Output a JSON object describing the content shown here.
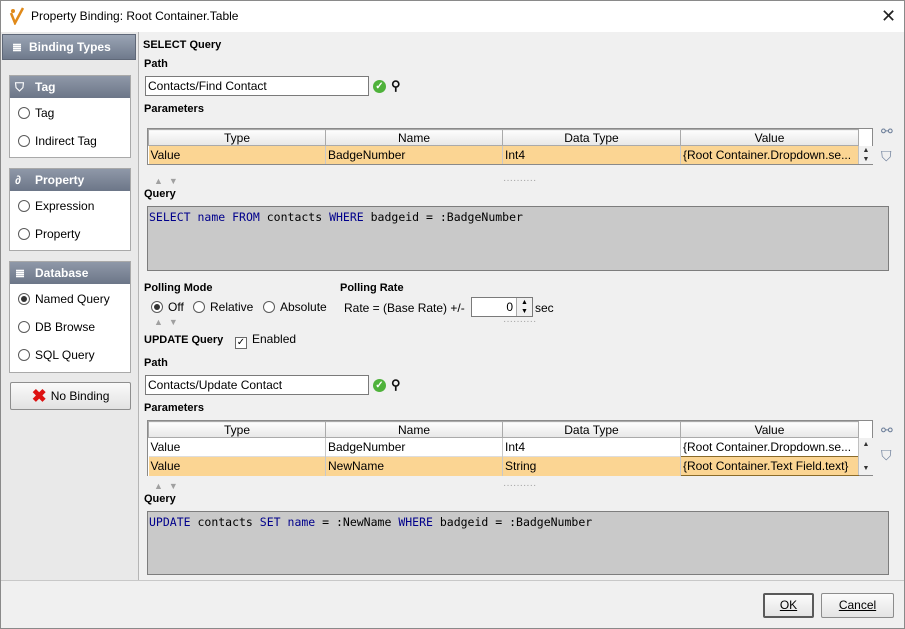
{
  "window": {
    "title": "Property Binding: Root Container.Table"
  },
  "left": {
    "header": "Binding Types",
    "groups": [
      {
        "title": "Tag",
        "items": [
          "Tag",
          "Indirect Tag"
        ]
      },
      {
        "title": "Property",
        "items": [
          "Expression",
          "Property"
        ]
      },
      {
        "title": "Database",
        "items": [
          "Named Query",
          "DB Browse",
          "SQL Query"
        ]
      }
    ],
    "selected": "Named Query",
    "no_binding": "No Binding"
  },
  "select": {
    "heading": "SELECT Query",
    "path_label": "Path",
    "path_value": "Contacts/Find Contact",
    "params_label": "Parameters",
    "columns": [
      "Type",
      "Name",
      "Data Type",
      "Value"
    ],
    "rows": [
      [
        "Value",
        "BadgeNumber",
        "Int4",
        "{Root Container.Dropdown.se..."
      ]
    ],
    "query_label": "Query",
    "query": [
      {
        "t": "SELECT",
        "k": true
      },
      {
        "t": " "
      },
      {
        "t": "name",
        "k": true
      },
      {
        "t": " "
      },
      {
        "t": "FROM",
        "k": true
      },
      {
        "t": " contacts "
      },
      {
        "t": "WHERE",
        "k": true
      },
      {
        "t": " badgeid = :BadgeNumber"
      }
    ]
  },
  "polling": {
    "mode_label": "Polling Mode",
    "modes": [
      "Off",
      "Relative",
      "Absolute"
    ],
    "selected_mode": "Off",
    "rate_label": "Polling Rate",
    "rate_text": "Rate = (Base Rate) +/-",
    "rate_value": "0",
    "rate_unit": "sec"
  },
  "update": {
    "heading": "UPDATE Query",
    "enabled_label": "Enabled",
    "enabled": true,
    "path_label": "Path",
    "path_value": "Contacts/Update Contact",
    "params_label": "Parameters",
    "columns": [
      "Type",
      "Name",
      "Data Type",
      "Value"
    ],
    "rows": [
      [
        "Value",
        "BadgeNumber",
        "Int4",
        "{Root Container.Dropdown.se..."
      ],
      [
        "Value",
        "NewName",
        "String",
        "{Root Container.Text Field.text}"
      ]
    ],
    "query_label": "Query",
    "query": [
      {
        "t": "UPDATE",
        "k": true
      },
      {
        "t": " contacts "
      },
      {
        "t": "SET",
        "k": true
      },
      {
        "t": " "
      },
      {
        "t": "name",
        "k": true
      },
      {
        "t": " = :NewName "
      },
      {
        "t": "WHERE",
        "k": true
      },
      {
        "t": " badgeid = :BadgeNumber"
      }
    ]
  },
  "buttons": {
    "ok": "OK",
    "cancel": "Cancel"
  }
}
